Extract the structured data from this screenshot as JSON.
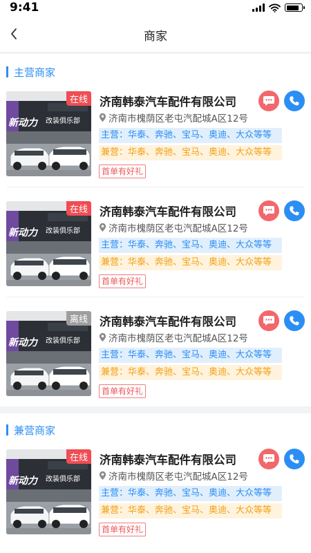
{
  "status_bar": {
    "time": "9:41",
    "battery_level": 0.85
  },
  "nav": {
    "title": "商家",
    "back_icon": "chevron-left-icon"
  },
  "colors": {
    "accent": "#2b8ef4",
    "online": "#ef4d53",
    "offline": "#9e9e9e",
    "message": "#f2676b",
    "side_tag": "#f2a118"
  },
  "sections": [
    {
      "title": "主营商家",
      "shops": [
        {
          "status": "在线",
          "name": "济南韩泰汽车配件有限公司",
          "address": "济南市槐荫区老屯汽配城A区12号",
          "main": "主营：华泰、奔驰、宝马、奥迪、大众等等",
          "side": "兼营：华泰、奔驰、宝马、奥迪、大众等等",
          "promo": "首单有好礼",
          "sign": "新动力",
          "sign_sub": "改装俱乐部"
        },
        {
          "status": "在线",
          "name": "济南韩泰汽车配件有限公司",
          "address": "济南市槐荫区老屯汽配城A区12号",
          "main": "主营：华泰、奔驰、宝马、奥迪、大众等等",
          "side": "兼营：华泰、奔驰、宝马、奥迪、大众等等",
          "promo": "首单有好礼",
          "sign": "新动力",
          "sign_sub": "改装俱乐部"
        },
        {
          "status": "离线",
          "name": "济南韩泰汽车配件有限公司",
          "address": "济南市槐荫区老屯汽配城A区12号",
          "main": "主营：华泰、奔驰、宝马、奥迪、大众等等",
          "side": "兼营：华泰、奔驰、宝马、奥迪、大众等等",
          "promo": "首单有好礼",
          "sign": "新动力",
          "sign_sub": "改装俱乐部"
        }
      ]
    },
    {
      "title": "兼营商家",
      "shops": [
        {
          "status": "在线",
          "name": "济南韩泰汽车配件有限公司",
          "address": "济南市槐荫区老屯汽配城A区12号",
          "main": "主营：华泰、奔驰、宝马、奥迪、大众等等",
          "side": "兼营：华泰、奔驰、宝马、奥迪、大众等等",
          "promo": "首单有好礼",
          "sign": "新动力",
          "sign_sub": "改装俱乐部"
        }
      ]
    }
  ]
}
